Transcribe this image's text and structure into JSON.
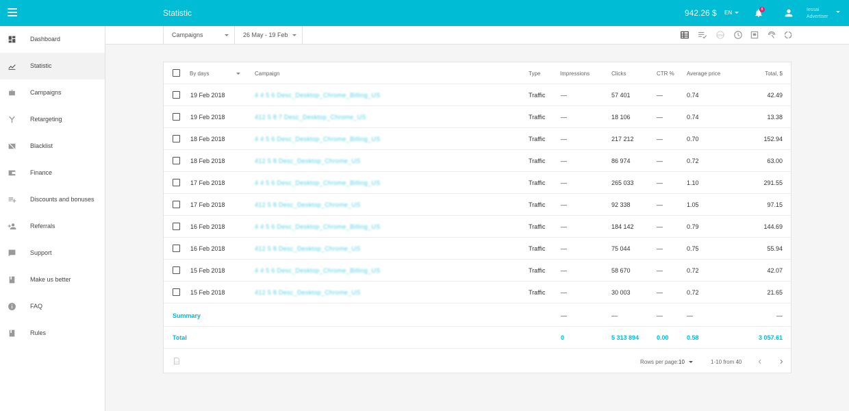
{
  "header": {
    "title": "Statistic",
    "balance": "942.26 $",
    "lang": "EN",
    "notification_count": "8",
    "user_name": "Iessai",
    "user_role": "Advertiser"
  },
  "sidebar": {
    "items": [
      {
        "label": "Dashboard",
        "icon": "dashboard-icon"
      },
      {
        "label": "Statistic",
        "icon": "chart-icon"
      },
      {
        "label": "Campaigns",
        "icon": "briefcase-icon"
      },
      {
        "label": "Retargeting",
        "icon": "fork-icon"
      },
      {
        "label": "Blacklist",
        "icon": "blacklist-icon"
      },
      {
        "label": "Finance",
        "icon": "wallet-icon"
      },
      {
        "label": "Discounts and bonuses",
        "icon": "playlist-add-icon"
      },
      {
        "label": "Referrals",
        "icon": "person-add-icon"
      },
      {
        "label": "Support",
        "icon": "chat-icon"
      },
      {
        "label": "Make us better",
        "icon": "book-icon"
      },
      {
        "label": "FAQ",
        "icon": "info-icon"
      },
      {
        "label": "Rules",
        "icon": "book-icon"
      }
    ]
  },
  "filters": {
    "group": "Campaigns",
    "date_range": "26 May - 19 Feb"
  },
  "table": {
    "columns": {
      "date": "By days",
      "campaign": "Campaign",
      "type": "Type",
      "impressions": "Impressions",
      "clicks": "Clicks",
      "ctr": "CTR %",
      "avg_price": "Average price",
      "total": "Total, $"
    },
    "rows": [
      {
        "date": "19 Feb 2018",
        "campaign": "4 4 5 6 Desc_Desktop_Chrome_Billing_US",
        "type": "Traffic",
        "impressions": "—",
        "clicks": "57 401",
        "ctr": "—",
        "avg_price": "0.74",
        "total": "42.49"
      },
      {
        "date": "19 Feb 2018",
        "campaign": "412 5 8 7 Desc_Desktop_Chrome_US",
        "type": "Traffic",
        "impressions": "—",
        "clicks": "18 106",
        "ctr": "—",
        "avg_price": "0.74",
        "total": "13.38"
      },
      {
        "date": "18 Feb 2018",
        "campaign": "4 4 5 6 Desc_Desktop_Chrome_Billing_US",
        "type": "Traffic",
        "impressions": "—",
        "clicks": "217 212",
        "ctr": "—",
        "avg_price": "0.70",
        "total": "152.94"
      },
      {
        "date": "18 Feb 2018",
        "campaign": "412 5 8 Desc_Desktop_Chrome_US",
        "type": "Traffic",
        "impressions": "—",
        "clicks": "86 974",
        "ctr": "—",
        "avg_price": "0.72",
        "total": "63.00"
      },
      {
        "date": "17 Feb 2018",
        "campaign": "4 4 5 6 Desc_Desktop_Chrome_Billing_US",
        "type": "Traffic",
        "impressions": "—",
        "clicks": "265 033",
        "ctr": "—",
        "avg_price": "1.10",
        "total": "291.55"
      },
      {
        "date": "17 Feb 2018",
        "campaign": "412 5 8 Desc_Desktop_Chrome_US",
        "type": "Traffic",
        "impressions": "—",
        "clicks": "92 338",
        "ctr": "—",
        "avg_price": "1.05",
        "total": "97.15"
      },
      {
        "date": "16 Feb 2018",
        "campaign": "4 4 5 6 Desc_Desktop_Chrome_Billing_US",
        "type": "Traffic",
        "impressions": "—",
        "clicks": "184 142",
        "ctr": "—",
        "avg_price": "0.79",
        "total": "144.69"
      },
      {
        "date": "16 Feb 2018",
        "campaign": "412 5 8 Desc_Desktop_Chrome_US",
        "type": "Traffic",
        "impressions": "—",
        "clicks": "75 044",
        "ctr": "—",
        "avg_price": "0.75",
        "total": "55.94"
      },
      {
        "date": "15 Feb 2018",
        "campaign": "4 4 5 6 Desc_Desktop_Chrome_Billing_US",
        "type": "Traffic",
        "impressions": "—",
        "clicks": "58 670",
        "ctr": "—",
        "avg_price": "0.72",
        "total": "42.07"
      },
      {
        "date": "15 Feb 2018",
        "campaign": "412 5 8 Desc_Desktop_Chrome_US",
        "type": "Traffic",
        "impressions": "—",
        "clicks": "30 003",
        "ctr": "—",
        "avg_price": "0.72",
        "total": "21.65"
      }
    ],
    "summary": {
      "label": "Summary",
      "impressions": "—",
      "clicks": "—",
      "ctr": "—",
      "avg_price": "—",
      "total": "—"
    },
    "total": {
      "label": "Total",
      "impressions": "0",
      "clicks": "5 313 894",
      "ctr": "0.00",
      "avg_price": "0.58",
      "total": "3 057.61"
    }
  },
  "pagination": {
    "rows_per_page_label": "Rows per page:",
    "rows_per_page": "10",
    "range": "1-10 from 40"
  },
  "colors": {
    "accent": "#00bcd4",
    "badge": "#e91e63"
  }
}
